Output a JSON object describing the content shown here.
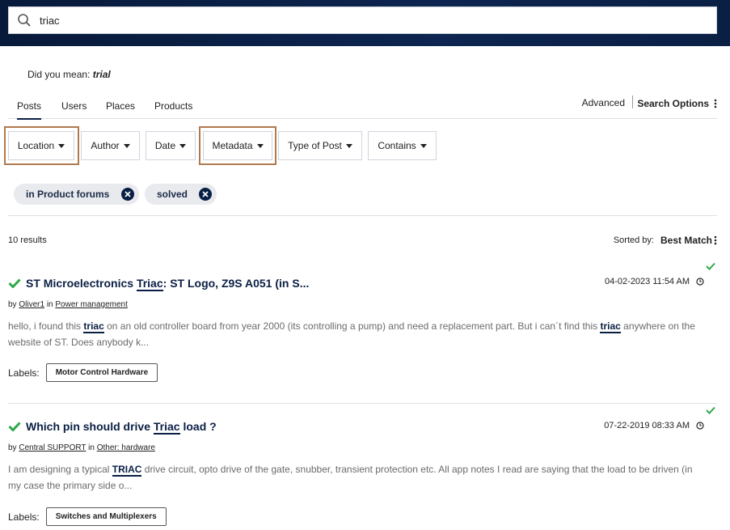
{
  "search": {
    "value": "triac"
  },
  "did_you_mean": {
    "prefix": "Did you mean:",
    "suggestion": "trial"
  },
  "tabs": [
    {
      "label": "Posts",
      "active": true
    },
    {
      "label": "Users",
      "active": false
    },
    {
      "label": "Places",
      "active": false
    },
    {
      "label": "Products",
      "active": false
    }
  ],
  "header_links": {
    "advanced": "Advanced",
    "search_options": "Search Options"
  },
  "filters": [
    {
      "label": "Location",
      "highlighted": true
    },
    {
      "label": "Author",
      "highlighted": false
    },
    {
      "label": "Date",
      "highlighted": false
    },
    {
      "label": "Metadata",
      "highlighted": true
    },
    {
      "label": "Type of Post",
      "highlighted": false
    },
    {
      "label": "Contains",
      "highlighted": false
    }
  ],
  "chips": [
    {
      "label": "in Product forums"
    },
    {
      "label": "solved"
    }
  ],
  "results": {
    "count": "10 results",
    "sorted_by": "Sorted by:",
    "sort_value": "Best Match"
  },
  "posts": [
    {
      "title_pre": "ST Microelectronics",
      "title_kw": "Triac",
      "title_post": ": ST Logo, Z9S A051 (in S...",
      "date": "04-02-2023 11:54 AM",
      "by": "by",
      "author": "Oliver1",
      "in": "in",
      "board": "Power management",
      "snippet_1": "hello, i found this",
      "snippet_kw1": "triac",
      "snippet_2": "on an old controller board from year 2000 (its controlling a pump) and need a replacement part. But i can´t find this",
      "snippet_kw2": "triac",
      "snippet_3": "anywhere on the website of ST. Does anybody k...",
      "labels_title": "Labels:",
      "label": "Motor Control Hardware"
    },
    {
      "title_pre": "Which pin should drive",
      "title_kw": "Triac",
      "title_post": "load ?",
      "date": "07-22-2019 08:33 AM",
      "by": "by",
      "author": "Central SUPPORT",
      "in": "in",
      "board": "Other: hardware",
      "snippet_1": "I am designing a typical",
      "snippet_kw1": "TRIAC",
      "snippet_2": "drive circuit, opto drive of the gate, snubber, transient protection etc. All app notes I read are saying that the load to be driven (in my case the primary side o...",
      "labels_title": "Labels:",
      "label": "Switches and Multiplexers"
    }
  ],
  "colors": {
    "navy": "#0a1f44",
    "solved_green": "#2ea84a",
    "highlight_box": "#b07a50"
  }
}
